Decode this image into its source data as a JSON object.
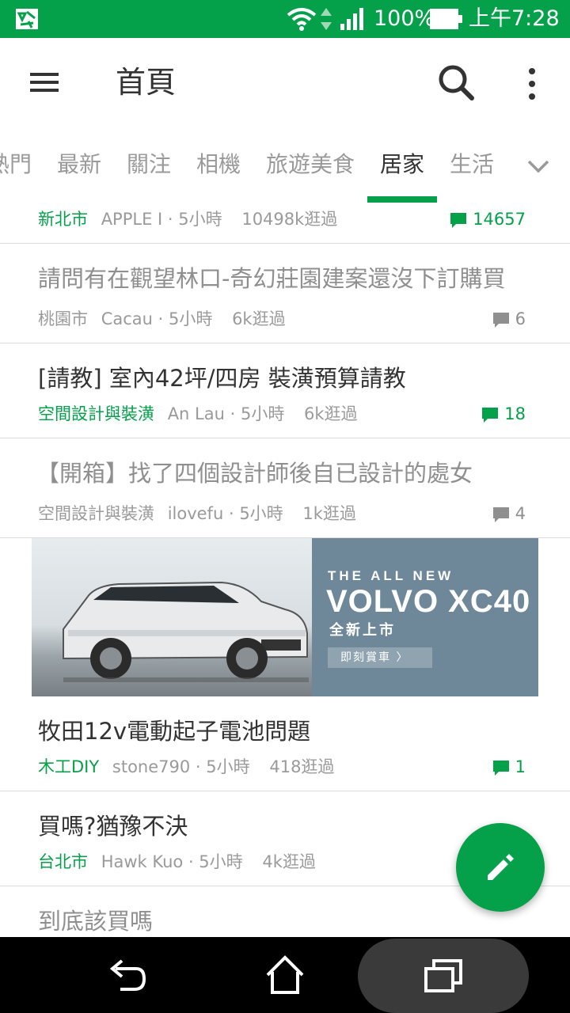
{
  "status_bar": {
    "battery": "100%",
    "time": "上午7:28"
  },
  "app_bar": {
    "title": "首頁"
  },
  "tabs": [
    {
      "label": "熱門",
      "active": false
    },
    {
      "label": "最新",
      "active": false
    },
    {
      "label": "關注",
      "active": false
    },
    {
      "label": "相機",
      "active": false
    },
    {
      "label": "旅遊美食",
      "active": false
    },
    {
      "label": "居家",
      "active": true
    },
    {
      "label": "生活",
      "active": false
    }
  ],
  "posts": [
    {
      "title": "",
      "category": "新北市",
      "author": "APPLE I",
      "time": "5小時",
      "views": "10498k逛過",
      "comments": "14657",
      "read": false
    },
    {
      "title": "請問有在觀望林口-奇幻莊園建案還沒下訂購買",
      "category": "桃園市",
      "author": "Cacau",
      "time": "5小時",
      "views": "6k逛過",
      "comments": "6",
      "read": true
    },
    {
      "title": "[請教] 室內42坪/四房 裝潢預算請教",
      "category": "空間設計與裝潢",
      "author": "An Lau",
      "time": "5小時",
      "views": "6k逛過",
      "comments": "18",
      "read": false
    },
    {
      "title": "【開箱】找了四個設計師後自已設計的處女",
      "category": "空間設計與裝潢",
      "author": "ilovefu",
      "time": "5小時",
      "views": "1k逛過",
      "comments": "4",
      "read": true
    },
    {
      "title": "牧田12v電動起子電池問題",
      "category": "木工DIY",
      "author": "stone790",
      "time": "5小時",
      "views": "418逛過",
      "comments": "1",
      "read": false
    },
    {
      "title": "買嗎?猶豫不決",
      "category": "台北市",
      "author": "Hawk Kuo",
      "time": "5小時",
      "views": "4k逛過",
      "comments": "",
      "read": false
    },
    {
      "title": "到底該買嗎",
      "category": "",
      "author": "",
      "time": "",
      "views": "",
      "comments": "",
      "read": true
    }
  ],
  "ad": {
    "line1": "THE ALL NEW",
    "line2": "VOLVO XC40",
    "line3": "全新上市",
    "button": "即刻賞車 〉"
  },
  "colors": {
    "brand_green": "#04a14a",
    "read_title": "#8f8f8f",
    "meta_gray": "#9a9a9a"
  }
}
